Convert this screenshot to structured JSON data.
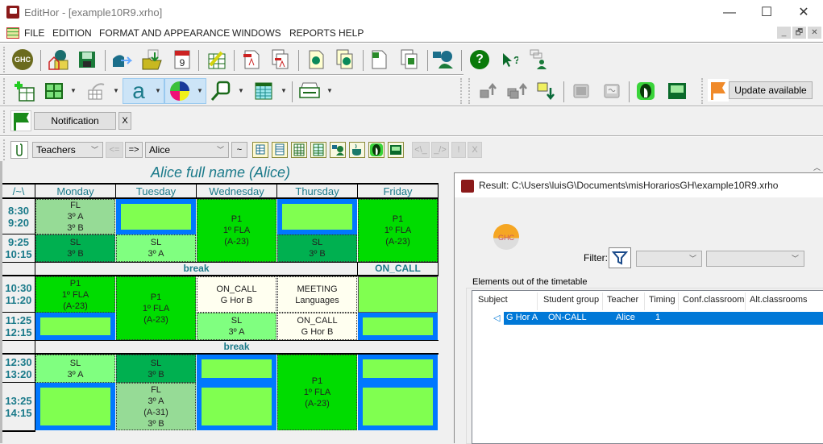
{
  "window": {
    "title": "EditHor - [example10R9.xrho]",
    "controls": {
      "minimize": "—",
      "maximize": "☐",
      "close": "✕"
    },
    "mdi_controls": {
      "minimize": "_",
      "restore": "🗗",
      "close": "✕"
    }
  },
  "menu": {
    "items": [
      "FILE",
      "EDITION",
      "FORMAT AND APPEARANCE",
      "WINDOWS",
      "REPORTS",
      "HELP"
    ]
  },
  "toolbar1": {
    "icons": [
      "ghc-logo-icon",
      "ghc-home-folder-icon",
      "save-icon",
      "send-icon",
      "open-folder-icon",
      "calendar-icon",
      "edit-grid-icon",
      "pdf-icon",
      "pdf-multi-icon",
      "web-page-icon",
      "web-pages-icon",
      "excel-icon",
      "excel-multi-icon",
      "users-icon",
      "help-icon",
      "context-help-icon",
      "chat-user-icon"
    ],
    "ghc_label": "GHC",
    "calendar_day": "9",
    "help_glyph": "?"
  },
  "toolbar2": {
    "icons": [
      "add-table-icon",
      "grid-layout-icon",
      "hand-grid-icon",
      "font-icon",
      "color-palette-icon",
      "zoom-icon",
      "table-icon",
      "printer-icon"
    ],
    "font_glyph": "a"
  },
  "toolbar3": {
    "icons": [
      "move-up-icon",
      "move-up-multi-icon",
      "move-down-icon",
      "gray-box-icon",
      "gray-wave-icon",
      "green-person-icon",
      "green-grid-icon"
    ]
  },
  "notification": {
    "label": "Notification",
    "close": "X"
  },
  "update": {
    "label": "Update available"
  },
  "filterbar": {
    "category": "Teachers",
    "prev": "<=",
    "next": "=>",
    "person": "Alice",
    "tilde": "~",
    "disabled_buttons": [
      "<\\_",
      "_/>",
      "!",
      "X"
    ]
  },
  "timetable": {
    "title": "Alice full name (Alice)",
    "corner": "/~\\",
    "days": [
      "Monday",
      "Tuesday",
      "Wednesday",
      "Thursday",
      "Friday"
    ],
    "times": [
      [
        "8:30",
        "9:20"
      ],
      [
        "9:25",
        "10:15"
      ],
      [
        "10:30",
        "11:20"
      ],
      [
        "11:25",
        "12:15"
      ],
      [
        "12:30",
        "13:20"
      ],
      [
        "13:25",
        "14:15"
      ]
    ],
    "breaks": [
      "break",
      "ON_CALL",
      "break"
    ],
    "cells": {
      "mon_1": [
        "FL",
        "3º A",
        "3º B"
      ],
      "mon_2": [
        "SL",
        "3º B"
      ],
      "mon_3": [
        "P1",
        "1º FLA",
        "(A-23)"
      ],
      "mon_5": [
        "SL",
        "3º A"
      ],
      "tue_2": [
        "SL",
        "3º A"
      ],
      "tue_34": [
        "P1",
        "1º FLA",
        "(A-23)"
      ],
      "tue_5": [
        "SL",
        "3º B"
      ],
      "tue_6": [
        "FL",
        "3º A",
        "(A-31)",
        "3º B"
      ],
      "wed_12": [
        "P1",
        "1º FLA",
        "(A-23)"
      ],
      "wed_3": [
        "ON_CALL",
        "G Hor B"
      ],
      "wed_4": [
        "SL",
        "3º A"
      ],
      "thu_2": [
        "SL",
        "3º B"
      ],
      "thu_3": [
        "MEETING",
        "Languages"
      ],
      "thu_4": [
        "ON_CALL",
        "G Hor B"
      ],
      "thu_56": [
        "P1",
        "1º FLA",
        "(A-23)"
      ],
      "fri_12": [
        "P1",
        "1º FLA",
        "(A-23)"
      ]
    }
  },
  "result": {
    "title": "Result: C:\\Users\\luisG\\Documents\\misHorariosGH\\example10R9.xrho",
    "logo": "GHC",
    "filter_label": "Filter:",
    "filter1": "",
    "filter2": "",
    "group_label": "Elements out of the timetable",
    "columns": [
      "Subject",
      "Student group",
      "Teacher",
      "Timing",
      "Conf.classroom",
      "Alt.classrooms"
    ],
    "rows": [
      {
        "subject": "G Hor A",
        "student_group": "ON-CALL",
        "teacher": "Alice",
        "timing": "1",
        "conf_classroom": "",
        "alt_classrooms": ""
      }
    ]
  }
}
